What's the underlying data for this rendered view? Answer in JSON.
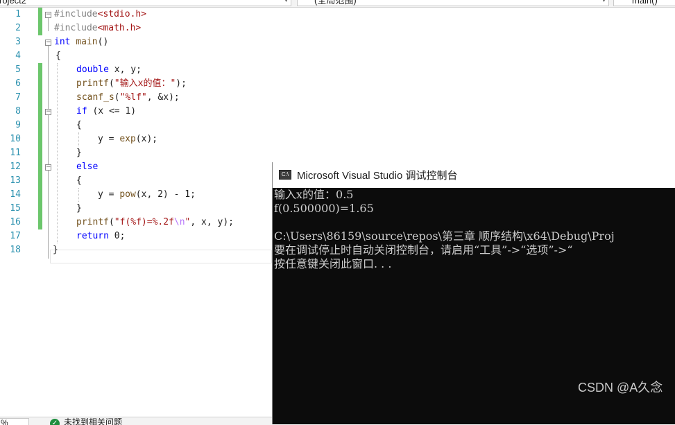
{
  "navbar": {
    "project": "roject2",
    "scope": "(全局范围)",
    "function": "main()"
  },
  "editor": {
    "line_numbers": [
      "1",
      "2",
      "3",
      "4",
      "5",
      "6",
      "7",
      "8",
      "9",
      "10",
      "11",
      "12",
      "13",
      "14",
      "15",
      "16",
      "17",
      "18"
    ],
    "lines": {
      "l1_pp": "#include",
      "l1_inc": "<stdio.h>",
      "l2_pp": "#include",
      "l2_inc": "<math.h>",
      "l3_kw": "int",
      "l3_fn": "main",
      "l3_rest": "()",
      "l4": "{",
      "l5_kw": "double",
      "l5_rest": " x, y;",
      "l6_fn": "printf",
      "l6_str": "\"输入x的值：\"",
      "l7_fn": "scanf_s",
      "l7_str": "\"%lf\"",
      "l7_rest": ", &x);",
      "l8_kw": "if",
      "l8_rest": " (x <= 1)",
      "l9": "{",
      "l10_rest": "y = ",
      "l10_fn": "exp",
      "l10_tail": "(x);",
      "l11": "}",
      "l12_kw": "else",
      "l13": "{",
      "l14_rest": "y = ",
      "l14_fn": "pow",
      "l14_tail": "(x, 2) - 1;",
      "l15": "}",
      "l16_fn": "printf",
      "l16_str1": "\"f(%f)=%.2f",
      "l16_esc": "\\n",
      "l16_str2": "\"",
      "l16_rest": ", x, y);",
      "l17_kw": "return",
      "l17_rest": " 0;",
      "l18": "}"
    }
  },
  "statusbar": {
    "zoom": "%",
    "status": "未找到相关问题"
  },
  "console": {
    "title": "Microsoft Visual Studio 调试控制台",
    "icon_label": "C:\\",
    "lines": [
      "输入x的值：0.5",
      "f(0.500000)=1.65",
      "",
      "C:\\Users\\86159\\source\\repos\\第三章 顺序结构\\x64\\Debug\\Proj",
      "要在调试停止时自动关闭控制台，请启用“工具”->“选项”->“",
      "按任意键关闭此窗口. . ."
    ]
  },
  "watermark": "CSDN @A久念"
}
